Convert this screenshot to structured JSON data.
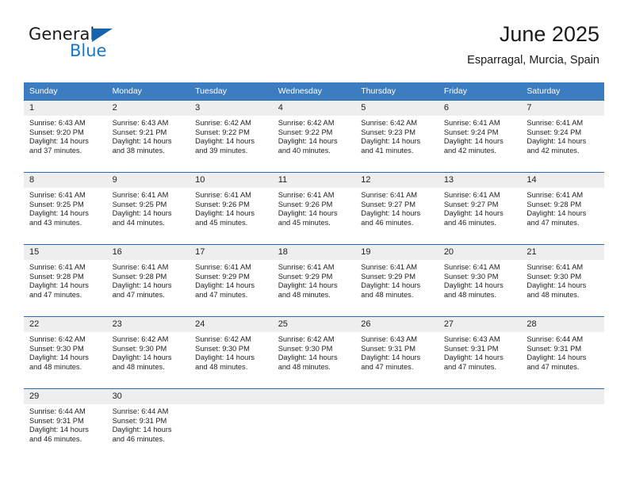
{
  "brand": {
    "name_top": "General",
    "name_bottom": "Blue",
    "accent_color": "#1878c8",
    "triangle_color": "#1464ad"
  },
  "header": {
    "title": "June 2025",
    "subtitle": "Esparragal, Murcia, Spain"
  },
  "theme": {
    "header_row_bg": "#3b7dc0",
    "row_border": "#2a68ac",
    "daynum_bg": "#eeeeee"
  },
  "calendar": {
    "weekday_headers": [
      "Sunday",
      "Monday",
      "Tuesday",
      "Wednesday",
      "Thursday",
      "Friday",
      "Saturday"
    ],
    "weeks": [
      [
        {
          "day": "1",
          "sunrise": "Sunrise: 6:43 AM",
          "sunset": "Sunset: 9:20 PM",
          "daylight_1": "Daylight: 14 hours",
          "daylight_2": "and 37 minutes."
        },
        {
          "day": "2",
          "sunrise": "Sunrise: 6:43 AM",
          "sunset": "Sunset: 9:21 PM",
          "daylight_1": "Daylight: 14 hours",
          "daylight_2": "and 38 minutes."
        },
        {
          "day": "3",
          "sunrise": "Sunrise: 6:42 AM",
          "sunset": "Sunset: 9:22 PM",
          "daylight_1": "Daylight: 14 hours",
          "daylight_2": "and 39 minutes."
        },
        {
          "day": "4",
          "sunrise": "Sunrise: 6:42 AM",
          "sunset": "Sunset: 9:22 PM",
          "daylight_1": "Daylight: 14 hours",
          "daylight_2": "and 40 minutes."
        },
        {
          "day": "5",
          "sunrise": "Sunrise: 6:42 AM",
          "sunset": "Sunset: 9:23 PM",
          "daylight_1": "Daylight: 14 hours",
          "daylight_2": "and 41 minutes."
        },
        {
          "day": "6",
          "sunrise": "Sunrise: 6:41 AM",
          "sunset": "Sunset: 9:24 PM",
          "daylight_1": "Daylight: 14 hours",
          "daylight_2": "and 42 minutes."
        },
        {
          "day": "7",
          "sunrise": "Sunrise: 6:41 AM",
          "sunset": "Sunset: 9:24 PM",
          "daylight_1": "Daylight: 14 hours",
          "daylight_2": "and 42 minutes."
        }
      ],
      [
        {
          "day": "8",
          "sunrise": "Sunrise: 6:41 AM",
          "sunset": "Sunset: 9:25 PM",
          "daylight_1": "Daylight: 14 hours",
          "daylight_2": "and 43 minutes."
        },
        {
          "day": "9",
          "sunrise": "Sunrise: 6:41 AM",
          "sunset": "Sunset: 9:25 PM",
          "daylight_1": "Daylight: 14 hours",
          "daylight_2": "and 44 minutes."
        },
        {
          "day": "10",
          "sunrise": "Sunrise: 6:41 AM",
          "sunset": "Sunset: 9:26 PM",
          "daylight_1": "Daylight: 14 hours",
          "daylight_2": "and 45 minutes."
        },
        {
          "day": "11",
          "sunrise": "Sunrise: 6:41 AM",
          "sunset": "Sunset: 9:26 PM",
          "daylight_1": "Daylight: 14 hours",
          "daylight_2": "and 45 minutes."
        },
        {
          "day": "12",
          "sunrise": "Sunrise: 6:41 AM",
          "sunset": "Sunset: 9:27 PM",
          "daylight_1": "Daylight: 14 hours",
          "daylight_2": "and 46 minutes."
        },
        {
          "day": "13",
          "sunrise": "Sunrise: 6:41 AM",
          "sunset": "Sunset: 9:27 PM",
          "daylight_1": "Daylight: 14 hours",
          "daylight_2": "and 46 minutes."
        },
        {
          "day": "14",
          "sunrise": "Sunrise: 6:41 AM",
          "sunset": "Sunset: 9:28 PM",
          "daylight_1": "Daylight: 14 hours",
          "daylight_2": "and 47 minutes."
        }
      ],
      [
        {
          "day": "15",
          "sunrise": "Sunrise: 6:41 AM",
          "sunset": "Sunset: 9:28 PM",
          "daylight_1": "Daylight: 14 hours",
          "daylight_2": "and 47 minutes."
        },
        {
          "day": "16",
          "sunrise": "Sunrise: 6:41 AM",
          "sunset": "Sunset: 9:28 PM",
          "daylight_1": "Daylight: 14 hours",
          "daylight_2": "and 47 minutes."
        },
        {
          "day": "17",
          "sunrise": "Sunrise: 6:41 AM",
          "sunset": "Sunset: 9:29 PM",
          "daylight_1": "Daylight: 14 hours",
          "daylight_2": "and 47 minutes."
        },
        {
          "day": "18",
          "sunrise": "Sunrise: 6:41 AM",
          "sunset": "Sunset: 9:29 PM",
          "daylight_1": "Daylight: 14 hours",
          "daylight_2": "and 48 minutes."
        },
        {
          "day": "19",
          "sunrise": "Sunrise: 6:41 AM",
          "sunset": "Sunset: 9:29 PM",
          "daylight_1": "Daylight: 14 hours",
          "daylight_2": "and 48 minutes."
        },
        {
          "day": "20",
          "sunrise": "Sunrise: 6:41 AM",
          "sunset": "Sunset: 9:30 PM",
          "daylight_1": "Daylight: 14 hours",
          "daylight_2": "and 48 minutes."
        },
        {
          "day": "21",
          "sunrise": "Sunrise: 6:41 AM",
          "sunset": "Sunset: 9:30 PM",
          "daylight_1": "Daylight: 14 hours",
          "daylight_2": "and 48 minutes."
        }
      ],
      [
        {
          "day": "22",
          "sunrise": "Sunrise: 6:42 AM",
          "sunset": "Sunset: 9:30 PM",
          "daylight_1": "Daylight: 14 hours",
          "daylight_2": "and 48 minutes."
        },
        {
          "day": "23",
          "sunrise": "Sunrise: 6:42 AM",
          "sunset": "Sunset: 9:30 PM",
          "daylight_1": "Daylight: 14 hours",
          "daylight_2": "and 48 minutes."
        },
        {
          "day": "24",
          "sunrise": "Sunrise: 6:42 AM",
          "sunset": "Sunset: 9:30 PM",
          "daylight_1": "Daylight: 14 hours",
          "daylight_2": "and 48 minutes."
        },
        {
          "day": "25",
          "sunrise": "Sunrise: 6:42 AM",
          "sunset": "Sunset: 9:30 PM",
          "daylight_1": "Daylight: 14 hours",
          "daylight_2": "and 48 minutes."
        },
        {
          "day": "26",
          "sunrise": "Sunrise: 6:43 AM",
          "sunset": "Sunset: 9:31 PM",
          "daylight_1": "Daylight: 14 hours",
          "daylight_2": "and 47 minutes."
        },
        {
          "day": "27",
          "sunrise": "Sunrise: 6:43 AM",
          "sunset": "Sunset: 9:31 PM",
          "daylight_1": "Daylight: 14 hours",
          "daylight_2": "and 47 minutes."
        },
        {
          "day": "28",
          "sunrise": "Sunrise: 6:44 AM",
          "sunset": "Sunset: 9:31 PM",
          "daylight_1": "Daylight: 14 hours",
          "daylight_2": "and 47 minutes."
        }
      ],
      [
        {
          "day": "29",
          "sunrise": "Sunrise: 6:44 AM",
          "sunset": "Sunset: 9:31 PM",
          "daylight_1": "Daylight: 14 hours",
          "daylight_2": "and 46 minutes."
        },
        {
          "day": "30",
          "sunrise": "Sunrise: 6:44 AM",
          "sunset": "Sunset: 9:31 PM",
          "daylight_1": "Daylight: 14 hours",
          "daylight_2": "and 46 minutes."
        },
        {
          "day": "",
          "sunrise": "",
          "sunset": "",
          "daylight_1": "",
          "daylight_2": ""
        },
        {
          "day": "",
          "sunrise": "",
          "sunset": "",
          "daylight_1": "",
          "daylight_2": ""
        },
        {
          "day": "",
          "sunrise": "",
          "sunset": "",
          "daylight_1": "",
          "daylight_2": ""
        },
        {
          "day": "",
          "sunrise": "",
          "sunset": "",
          "daylight_1": "",
          "daylight_2": ""
        },
        {
          "day": "",
          "sunrise": "",
          "sunset": "",
          "daylight_1": "",
          "daylight_2": ""
        }
      ]
    ]
  }
}
